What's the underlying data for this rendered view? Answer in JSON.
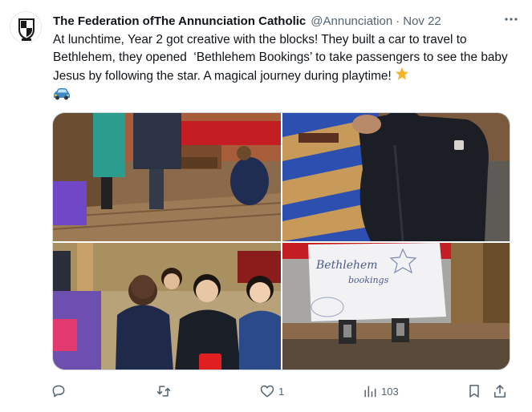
{
  "tweet": {
    "author_name": "The Federation ofThe Annunciation Catholic",
    "handle": "@Annunciation",
    "separator": "·",
    "time": "Nov 22",
    "text": "At lunchtime, Year 2 got creative with the blocks! They built a car to travel to Bethlehem, they opened  ‘Bethlehem Bookings’ to take passengers to see the baby Jesus by following the star. A magical journey during playtime! ",
    "emojis": [
      "star-emoji",
      "car-emoji"
    ],
    "photos": [
      {
        "name": "photo-children-building-blocks"
      },
      {
        "name": "photo-child-with-wooden-car"
      },
      {
        "name": "photo-children-smiling"
      },
      {
        "name": "photo-bethlehem-bookings-sign",
        "sign_text": "Bethlehem bookings"
      }
    ],
    "actions": {
      "reply_count": "",
      "retweet_count": "",
      "like_count": "1",
      "views_count": "103"
    },
    "colors": {
      "text": "#0f1419",
      "secondary": "#536471",
      "border": "#cfd9de"
    }
  }
}
